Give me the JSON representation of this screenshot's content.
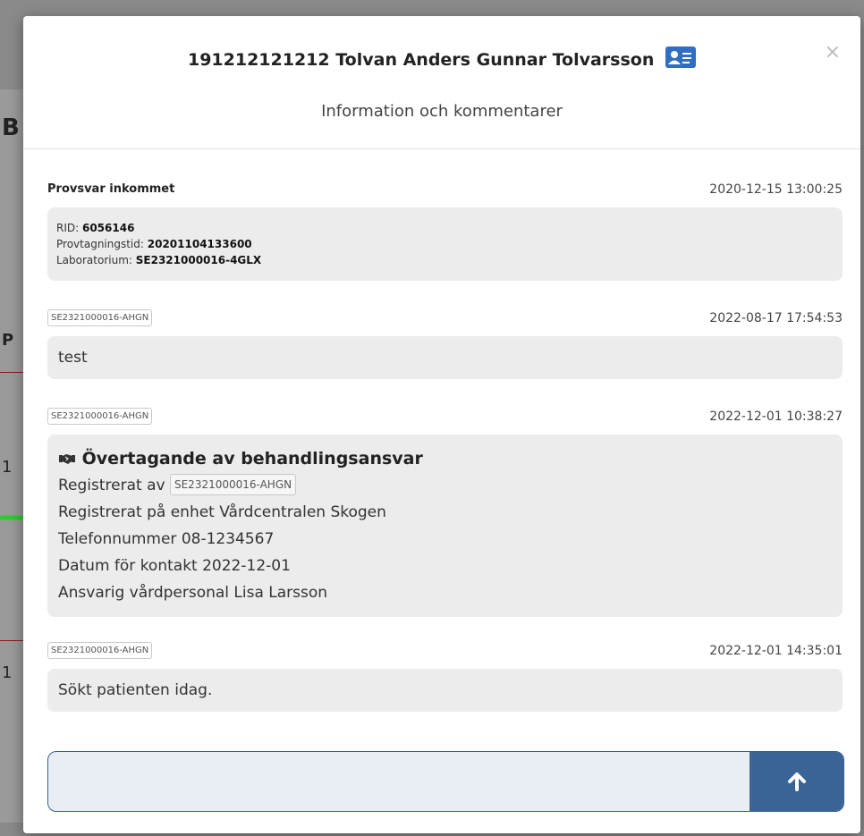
{
  "background": {
    "fragments": [
      "B",
      "P",
      "1",
      "1"
    ]
  },
  "header": {
    "title": "191212121212 Tolvan Anders Gunnar Tolvarsson",
    "subtitle": "Information och kommentarer",
    "close_label": "×"
  },
  "messages": [
    {
      "sender": "Provsvar inkommet",
      "timestamp": "2020-12-15 13:00:25",
      "lines": [
        {
          "label": "RID: ",
          "value": "6056146"
        },
        {
          "label": "Provtagningstid: ",
          "value": "20201104133600"
        },
        {
          "label": "Laboratorium: ",
          "value": "SE2321000016-4GLX"
        }
      ]
    },
    {
      "sender": "SE2321000016-AHGN",
      "timestamp": "2022-08-17 17:54:53",
      "text": "test"
    },
    {
      "sender": "SE2321000016-AHGN",
      "timestamp": "2022-12-01 10:38:27",
      "title": "Övertagande av behandlingsansvar",
      "registered_by_label": "Registrerat av",
      "registered_by_value": "SE2321000016-AHGN",
      "lines": [
        "Registrerat på enhet Vårdcentralen Skogen",
        "Telefonnummer 08-1234567",
        "Datum för kontakt 2022-12-01",
        "Ansvarig vårdpersonal Lisa Larsson"
      ]
    },
    {
      "sender": "SE2321000016-AHGN",
      "timestamp": "2022-12-01 14:35:01",
      "text": "Sökt patienten idag."
    }
  ],
  "composer": {
    "value": "",
    "placeholder": ""
  },
  "icons": {
    "patient_card": "id-card-icon",
    "handshake": "handshake-icon",
    "send": "arrow-up-icon"
  },
  "colors": {
    "accent": "#3a6396",
    "badge": "#2f6ec0",
    "bubble": "#ececec"
  }
}
